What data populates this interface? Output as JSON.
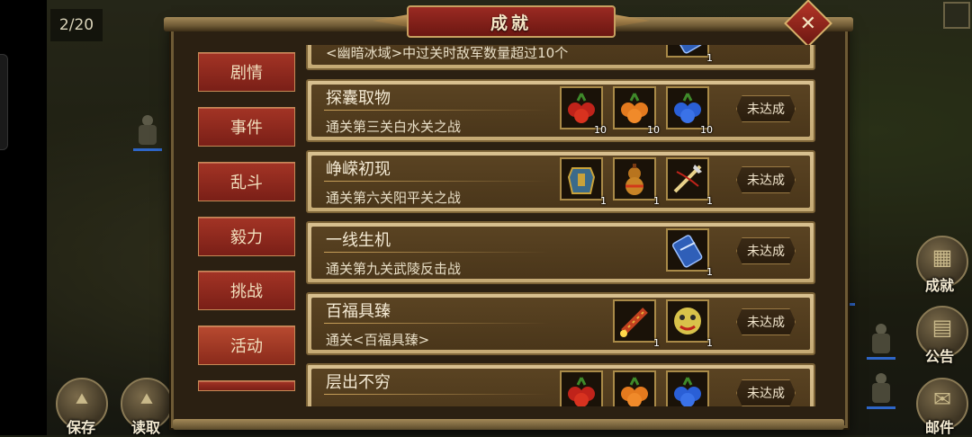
{
  "hud": {
    "stage_counter": "2/20",
    "buttons": [
      {
        "label": "保存",
        "icon": "save-icon"
      },
      {
        "label": "读取",
        "icon": "load-icon"
      },
      {
        "label": "成就",
        "icon": "achievement-icon"
      },
      {
        "label": "公告",
        "icon": "announcement-icon"
      },
      {
        "label": "邮件",
        "icon": "mail-icon"
      }
    ]
  },
  "dialog": {
    "title": "成就",
    "close_icon": "close-icon"
  },
  "tabs": [
    {
      "label": "剧情"
    },
    {
      "label": "事件"
    },
    {
      "label": "乱斗"
    },
    {
      "label": "毅力"
    },
    {
      "label": "挑战"
    },
    {
      "label": "活动"
    },
    {
      "label": ""
    }
  ],
  "achievements": [
    {
      "title": "",
      "desc": "<幽暗冰域>中过关时敌军数量超过10个",
      "status": "",
      "rewards": [
        {
          "icon": "scroll-icon",
          "qty": "1",
          "color": "#2f5fb8"
        }
      ]
    },
    {
      "title": "探囊取物",
      "desc": "通关第三关白水关之战",
      "status": "未达成",
      "rewards": [
        {
          "icon": "red-fruit-icon",
          "qty": "10",
          "color": "#c0231a"
        },
        {
          "icon": "orange-fruit-icon",
          "qty": "10",
          "color": "#e47a1e"
        },
        {
          "icon": "blue-fruit-icon",
          "qty": "10",
          "color": "#2a5fd6"
        }
      ]
    },
    {
      "title": "峥嵘初现",
      "desc": "通关第六关阳平关之战",
      "status": "未达成",
      "rewards": [
        {
          "icon": "armor-icon",
          "qty": "1",
          "color": "#3a6a8a"
        },
        {
          "icon": "gourd-icon",
          "qty": "1",
          "color": "#b8741e"
        },
        {
          "icon": "weapon-icon",
          "qty": "1",
          "color": "#b89a5a"
        }
      ]
    },
    {
      "title": "一线生机",
      "desc": "通关第九关武陵反击战",
      "status": "未达成",
      "rewards": [
        {
          "icon": "scroll-icon",
          "qty": "1",
          "color": "#2f5fb8"
        }
      ]
    },
    {
      "title": "百福具臻",
      "desc": "通关<百福具臻>",
      "status": "未达成",
      "rewards": [
        {
          "icon": "firecracker-icon",
          "qty": "1",
          "color": "#c2411f"
        },
        {
          "icon": "lion-mask-icon",
          "qty": "1",
          "color": "#d8c24a"
        }
      ]
    },
    {
      "title": "层出不穷",
      "desc": "",
      "status": "未达成",
      "rewards": [
        {
          "icon": "red-fruit-icon",
          "qty": "",
          "color": "#c0231a"
        },
        {
          "icon": "orange-fruit-icon",
          "qty": "",
          "color": "#e47a1e"
        },
        {
          "icon": "blue-fruit-icon",
          "qty": "",
          "color": "#2a5fd6"
        }
      ]
    }
  ]
}
